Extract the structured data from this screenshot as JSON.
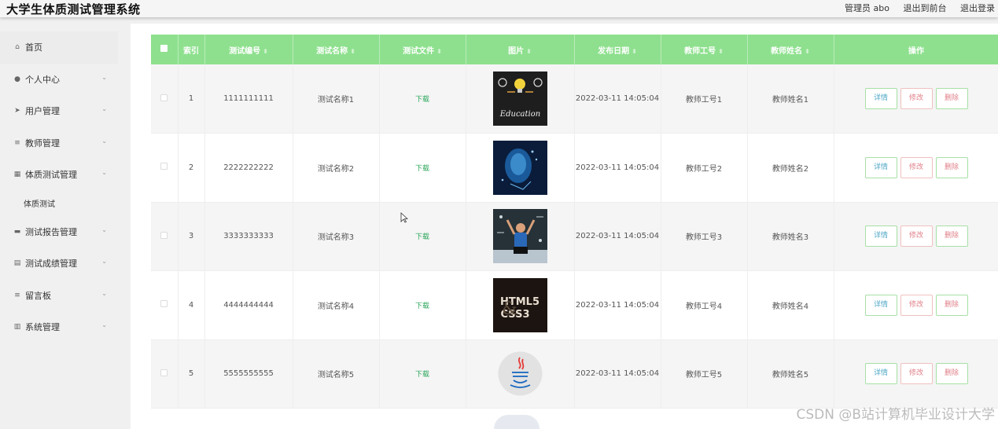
{
  "header": {
    "title": "大学生体质测试管理系统",
    "admin": "管理员 abo",
    "front": "退出到前台",
    "logout": "退出登录"
  },
  "sidebar": {
    "items": [
      {
        "label": "首页",
        "icon": "home-icon",
        "glyph": "⌂"
      },
      {
        "label": "个人中心",
        "icon": "user-icon",
        "glyph": "●"
      },
      {
        "label": "用户管理",
        "icon": "send-icon",
        "glyph": "➤"
      },
      {
        "label": "教师管理",
        "icon": "menu-icon",
        "glyph": "≡"
      },
      {
        "label": "体质测试管理",
        "icon": "grid-icon",
        "glyph": "▦"
      },
      {
        "label": "测试报告管理",
        "icon": "monitor-icon",
        "glyph": "▬"
      },
      {
        "label": "测试成绩管理",
        "icon": "doc-icon",
        "glyph": "▤"
      },
      {
        "label": "留言板",
        "icon": "list-icon",
        "glyph": "≡"
      },
      {
        "label": "系统管理",
        "icon": "bar-chart-icon",
        "glyph": "▥"
      }
    ],
    "sub": "体质测试"
  },
  "table": {
    "headers": [
      "索引",
      "测试编号",
      "测试名称",
      "测试文件",
      "图片",
      "发布日期",
      "教师工号",
      "教师姓名",
      "操作"
    ],
    "rows": [
      {
        "index": "1",
        "code": "1111111111",
        "name": "测试名称1",
        "file": "下载",
        "image": "education-thumbnail",
        "date": "2022-03-11 14:05:04",
        "tid": "教师工号1",
        "tname": "教师姓名1"
      },
      {
        "index": "2",
        "code": "2222222222",
        "name": "测试名称2",
        "file": "下载",
        "image": "ai-brain-thumbnail",
        "date": "2022-03-11 14:05:04",
        "tid": "教师工号2",
        "tname": "教师姓名2"
      },
      {
        "index": "3",
        "code": "3333333333",
        "name": "测试名称3",
        "file": "下载",
        "image": "student-chalkboard-thumbnail",
        "date": "2022-03-11 14:05:04",
        "tid": "教师工号3",
        "tname": "教师姓名3"
      },
      {
        "index": "4",
        "code": "4444444444",
        "name": "测试名称4",
        "file": "下载",
        "image": "html5-css3-thumbnail",
        "date": "2022-03-11 14:05:04",
        "tid": "教师工号4",
        "tname": "教师姓名4"
      },
      {
        "index": "5",
        "code": "5555555555",
        "name": "测试名称5",
        "file": "下载",
        "image": "java-logo-thumbnail",
        "date": "2022-03-11 14:05:04",
        "tid": "教师工号5",
        "tname": "教师姓名5"
      }
    ],
    "actions": {
      "detail": "详情",
      "edit": "修改",
      "delete": "删除"
    }
  },
  "thumb_text": {
    "education": "Education",
    "html": "HTML5",
    "css": "CSS3"
  },
  "watermark": "CSDN @B站计算机毕业设计大学",
  "colors": {
    "header_green": "#8ee08e",
    "download_green": "#2aa65a"
  }
}
